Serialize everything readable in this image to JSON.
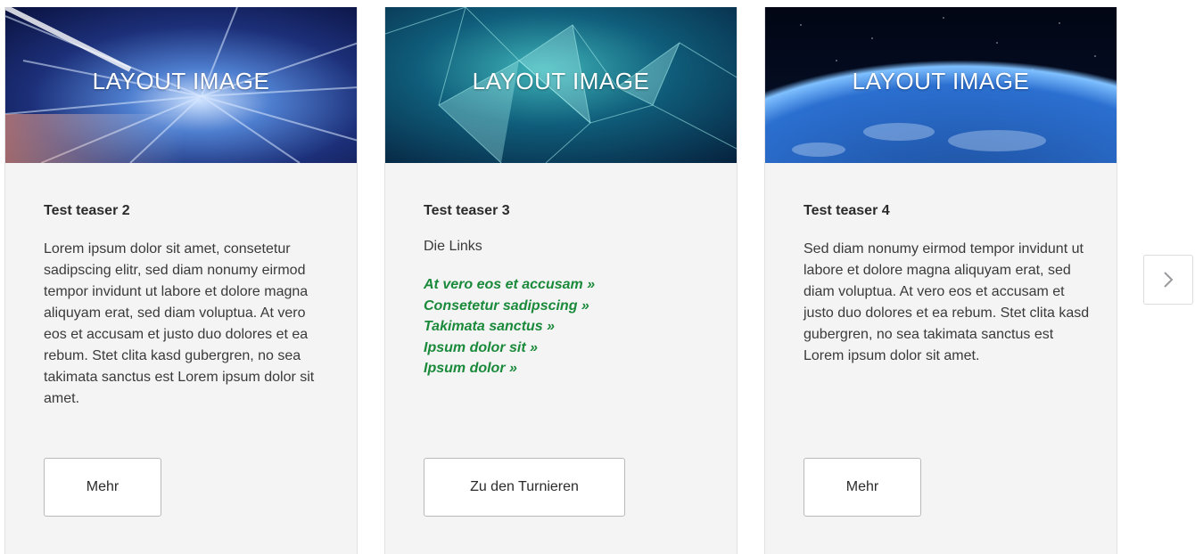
{
  "cards": [
    {
      "image_label": "LAYOUT IMAGE",
      "title": "Test teaser 2",
      "text": "Lorem ipsum dolor sit amet, consetetur sadipscing elitr, sed diam nonumy eirmod tempor invidunt ut labore et dolore magna aliquyam erat, sed diam voluptua. At vero eos et accusam et justo duo dolores et ea rebum. Stet clita kasd gubergren, no sea takimata sanctus est Lorem ipsum dolor sit amet.",
      "button_label": "Mehr"
    },
    {
      "image_label": "LAYOUT IMAGE",
      "title": "Test teaser 3",
      "intro": "Die Links",
      "links": [
        "At vero eos et accusam »",
        "Consetetur sadipscing »",
        "Takimata sanctus »",
        "Ipsum dolor sit »",
        "Ipsum dolor »"
      ],
      "button_label": "Zu den Turnieren"
    },
    {
      "image_label": "LAYOUT IMAGE",
      "title": "Test teaser 4",
      "text": "Sed diam nonumy eirmod tempor invidunt ut labore et dolore magna aliquyam erat, sed diam voluptua. At vero eos et accusam et justo duo dolores et ea rebum. Stet clita kasd gubergren, no sea takimata sanctus est Lorem ipsum dolor sit amet.",
      "button_label": "Mehr"
    }
  ],
  "navigation": {
    "next_icon": "chevron-right-icon"
  },
  "colors": {
    "card_background": "#f4f4f5",
    "link_color": "#1a8a3a",
    "button_border": "#b9b9bc"
  }
}
